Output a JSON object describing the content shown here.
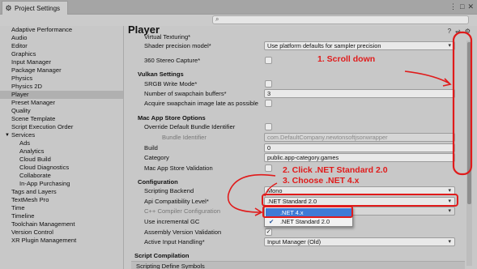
{
  "window": {
    "tab_title": "Project Settings"
  },
  "sidebar": {
    "items": [
      "Adaptive Performance",
      "Audio",
      "Editor",
      "Graphics",
      "Input Manager",
      "Package Manager",
      "Physics",
      "Physics 2D",
      "Player",
      "Preset Manager",
      "Quality",
      "Scene Template",
      "Script Execution Order",
      "Services",
      "Ads",
      "Analytics",
      "Cloud Build",
      "Cloud Diagnostics",
      "Collaborate",
      "In-App Purchasing",
      "Tags and Layers",
      "TextMesh Pro",
      "Time",
      "Timeline",
      "Toolchain Management",
      "Version Control",
      "XR Plugin Management"
    ],
    "selected": "Player"
  },
  "main": {
    "title": "Player",
    "virtual_texturing": "Virtual Texturing*",
    "shader_precision_label": "Shader precision model*",
    "shader_precision_value": "Use platform defaults for sampler precision",
    "stereo_label": "360 Stereo Capture*",
    "vulkan_section": "Vulkan Settings",
    "srgb_label": "SRGB Write Mode*",
    "swapchain_label": "Number of swapchain buffers*",
    "swapchain_value": "3",
    "acquire_label": "Acquire swapchain image late as possible",
    "mac_section": "Mac App Store Options",
    "override_bundle_label": "Override Default Bundle Identifier",
    "bundle_id_label": "Bundle Identifier",
    "bundle_id_value": "com.DefaultCompany.newtonsoftjsonwrapper",
    "build_label": "Build",
    "build_value": "0",
    "category_label": "Category",
    "category_value": "public.app-category.games",
    "mac_validation_label": "Mac App Store Validation",
    "config_section": "Configuration",
    "scripting_backend_label": "Scripting Backend",
    "scripting_backend_value": "Mono",
    "api_compat_label": "Api Compatibility Level*",
    "api_compat_value": ".NET Standard 2.0",
    "cpp_compiler_label": "C++ Compiler Configuration",
    "incremental_gc_label": "Use incremental GC",
    "assembly_validation_label": "Assembly Version Validation",
    "active_input_label": "Active Input Handling*",
    "active_input_value": "Input Manager (Old)",
    "script_compilation_section": "Script Compilation",
    "scripting_define_label": "Scripting Define Symbols"
  },
  "popup": {
    "options": [
      ".NET 4.x",
      ".NET Standard 2.0"
    ],
    "highlighted": ".NET 4.x",
    "checked": ".NET Standard 2.0"
  },
  "annotations": {
    "step1": "1. Scroll down",
    "step2": "2. Click .NET Standard 2.0",
    "step3": "3. Choose .NET 4.x"
  },
  "colors": {
    "annotation": "#e01b1b",
    "highlight": "#3f7bd6"
  }
}
